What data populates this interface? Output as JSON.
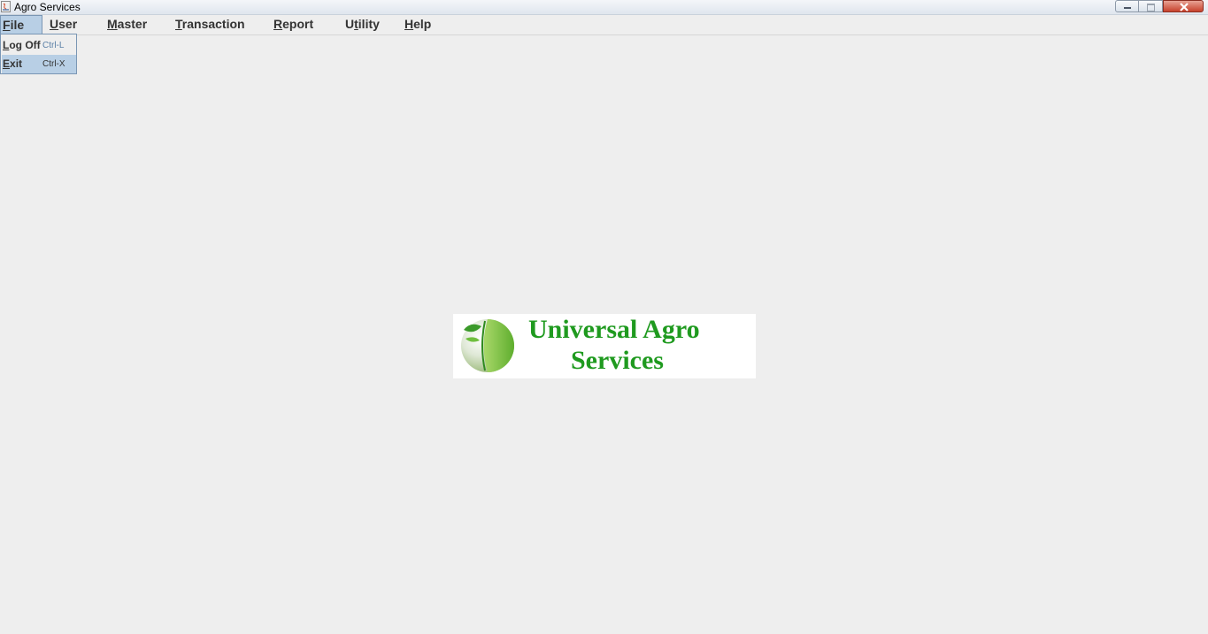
{
  "window": {
    "title": "Agro Services"
  },
  "menubar": {
    "items": [
      {
        "label": "File",
        "mnemonic_index": 0
      },
      {
        "label": "User",
        "mnemonic_index": 0
      },
      {
        "label": "Master",
        "mnemonic_index": 0
      },
      {
        "label": "Transaction",
        "mnemonic_index": 0
      },
      {
        "label": "Report",
        "mnemonic_index": 0
      },
      {
        "label": "Utility",
        "mnemonic_index": 1
      },
      {
        "label": "Help",
        "mnemonic_index": 0
      }
    ]
  },
  "file_menu": {
    "items": [
      {
        "label": "Log Off",
        "shortcut": "Ctrl-L"
      },
      {
        "label": "Exit",
        "shortcut": "Ctrl-X"
      }
    ]
  },
  "logo": {
    "line1": "Universal Agro",
    "line2": "Services"
  },
  "colors": {
    "background": "#eeeeee",
    "menu_highlight": "#b8cfe5",
    "logo_green": "#1f9a1f"
  }
}
